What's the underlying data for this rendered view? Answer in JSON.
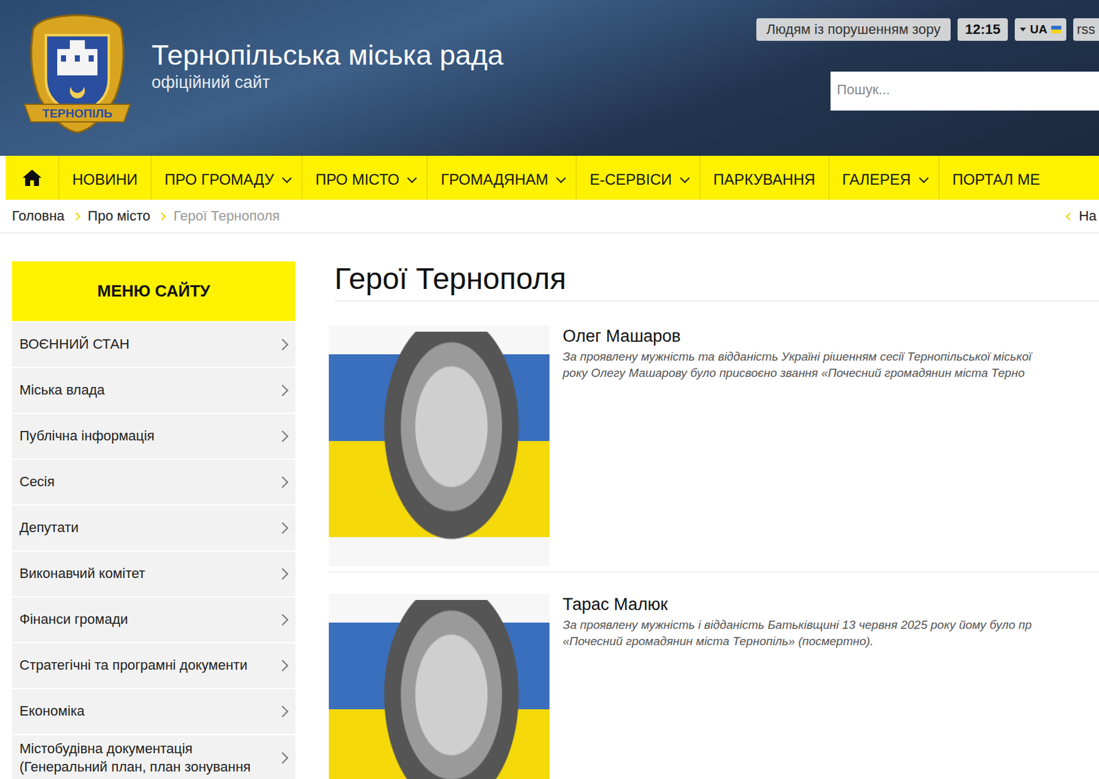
{
  "header": {
    "logo_ribbon": "ТЕРНОПІЛЬ",
    "title": "Тернопільська міська рада",
    "subtitle": "офіційний сайт",
    "accessibility_button": "Людям із порушенням зору",
    "time": "12:15",
    "language": "UA",
    "rss": "rss",
    "search": {
      "placeholder": "Пошук..."
    }
  },
  "nav": {
    "items": [
      {
        "label": "НОВИНИ",
        "dropdown": false
      },
      {
        "label": "ПРО ГРОМАДУ",
        "dropdown": true
      },
      {
        "label": "ПРО МІСТО",
        "dropdown": true
      },
      {
        "label": "ГРОМАДЯНАМ",
        "dropdown": true
      },
      {
        "label": "Е-СЕРВІСИ",
        "dropdown": true
      },
      {
        "label": "ПАРКУВАННЯ",
        "dropdown": false
      },
      {
        "label": "ГАЛЕРЕЯ",
        "dropdown": true
      },
      {
        "label": "ПОРТАЛ МЕ",
        "dropdown": false
      }
    ]
  },
  "breadcrumb": {
    "items": [
      {
        "label": "Головна",
        "current": false
      },
      {
        "label": "Про місто",
        "current": false
      },
      {
        "label": "Герої Тернополя",
        "current": true
      }
    ],
    "back": "На"
  },
  "sidebar": {
    "title": "МЕНЮ САЙТУ",
    "items": [
      "ВОЄННИЙ СТАН",
      "Міська влада",
      "Публічна інформація",
      "Сесія",
      "Депутати",
      "Виконавчий комітет",
      "Фінанси громади",
      "Стратегічні та програмні документи",
      "Економіка",
      "Містобудівна документація (Генеральний план, план зонування"
    ]
  },
  "main": {
    "heading": "Герої Тернополя",
    "heroes": [
      {
        "name": "Олег Машаров",
        "lines": [
          "За проявлену мужність та відданість Україні рішенням сесії Тернопільської міської",
          "року Олегу Машарову було присвоєно звання «Почесний громадянин міста Терно"
        ]
      },
      {
        "name": "Тарас Малюк",
        "lines": [
          "За проявлену мужність і відданість Батьківщині 13 червня 2025 року йому було пр",
          "«Почесний громадянин міста Тернопіль» (посмертно)."
        ]
      }
    ]
  }
}
